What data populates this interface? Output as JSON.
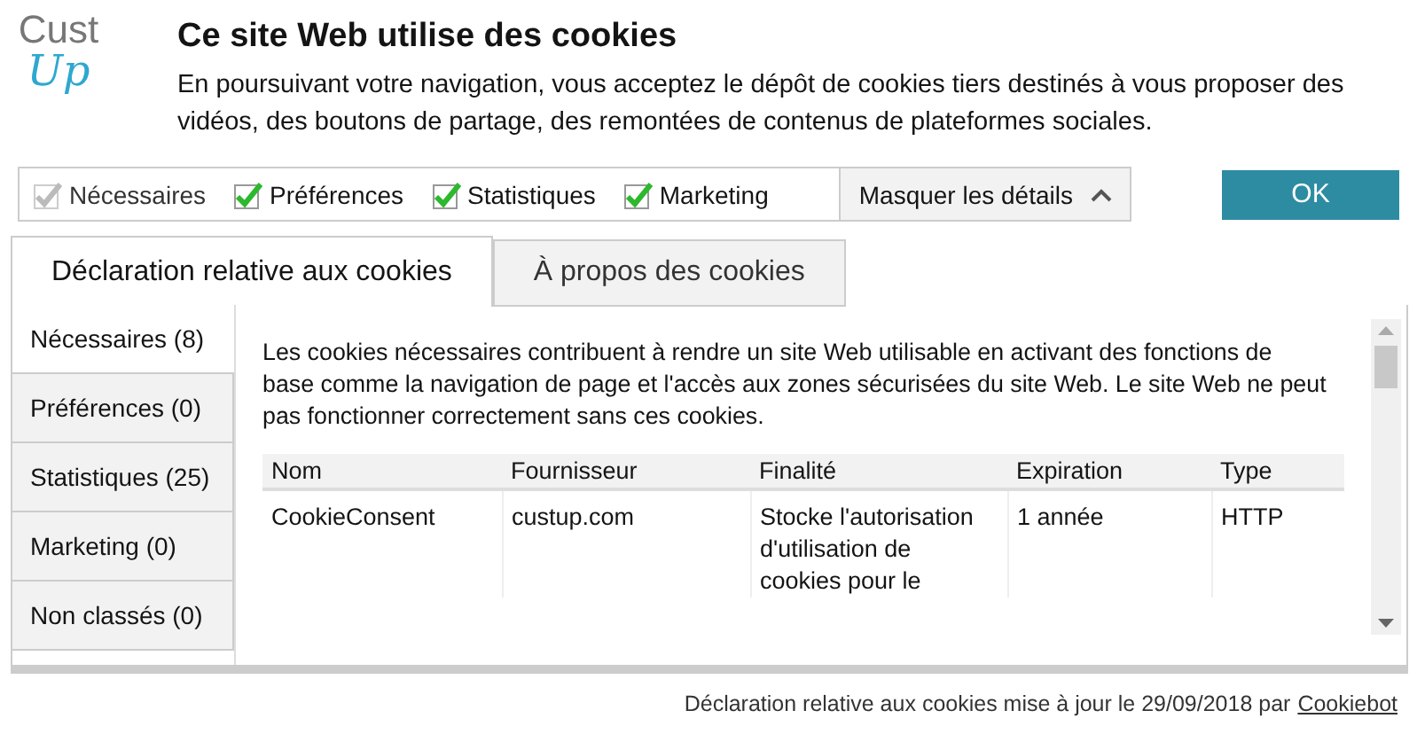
{
  "logo": {
    "top": "Cust",
    "bottom": "Up"
  },
  "title": "Ce site Web utilise des cookies",
  "message": "En poursuivant votre navigation, vous acceptez le dépôt de cookies tiers destinés à vous proposer des vidéos, des boutons de partage, des remontées de contenus de plateformes sociales.",
  "consent_options": [
    {
      "label": "Nécessaires",
      "checked": true,
      "disabled": true
    },
    {
      "label": "Préférences",
      "checked": true,
      "disabled": false
    },
    {
      "label": "Statistiques",
      "checked": true,
      "disabled": false
    },
    {
      "label": "Marketing",
      "checked": true,
      "disabled": false
    }
  ],
  "details_toggle": {
    "label": "Masquer les détails",
    "expanded": true
  },
  "ok_button": "OK",
  "tabs": [
    {
      "label": "Déclaration relative aux cookies",
      "selected": true
    },
    {
      "label": "À propos des cookies",
      "selected": false
    }
  ],
  "categories": [
    {
      "label": "Nécessaires (8)",
      "selected": true
    },
    {
      "label": "Préférences (0)",
      "selected": false
    },
    {
      "label": "Statistiques (25)",
      "selected": false
    },
    {
      "label": "Marketing (0)",
      "selected": false
    },
    {
      "label": "Non classés (0)",
      "selected": false
    }
  ],
  "description": "Les cookies nécessaires contribuent à rendre un site Web utilisable en activant des fonctions de base comme la navigation de page et l'accès aux zones sécurisées du site Web. Le site Web ne peut pas fonctionner correctement sans ces cookies.",
  "table": {
    "columns": [
      "Nom",
      "Fournisseur",
      "Finalité",
      "Expiration",
      "Type"
    ],
    "rows": [
      [
        "CookieConsent",
        "custup.com",
        "Stocke l'autorisation d'utilisation de cookies pour le",
        "1 année",
        "HTTP"
      ]
    ]
  },
  "footer": {
    "text": "Déclaration relative aux cookies mise à jour le 29/09/2018 par",
    "link": "Cookiebot"
  }
}
